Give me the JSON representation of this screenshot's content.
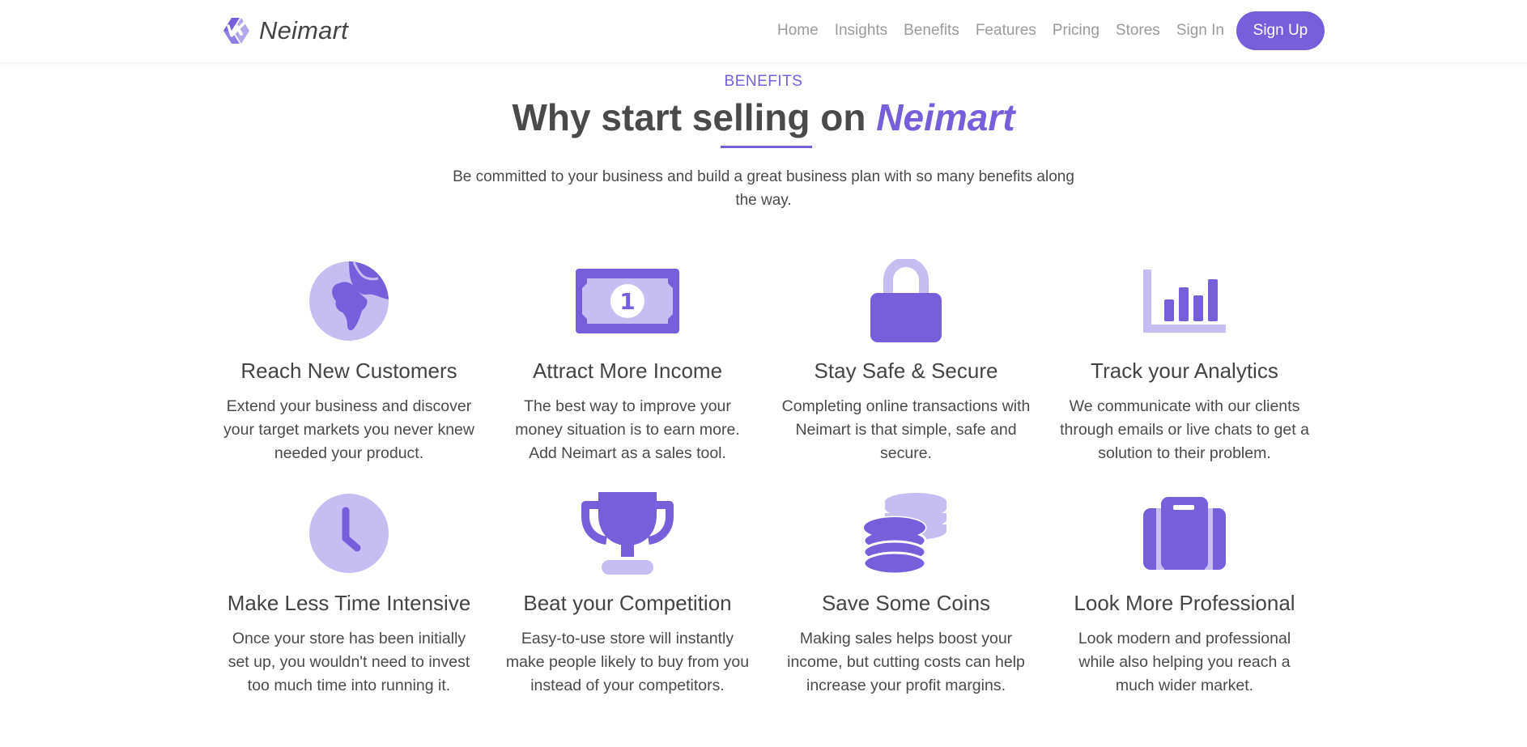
{
  "brand": {
    "name": "Neimart",
    "logo_icon": "neimart-logo-icon"
  },
  "nav": {
    "links": [
      "Home",
      "Insights",
      "Benefits",
      "Features",
      "Pricing",
      "Stores",
      "Sign In"
    ],
    "cta": "Sign Up"
  },
  "benefits": {
    "eyebrow": "BENEFITS",
    "title_lead": "Why start selling on ",
    "title_accent": "Neimart",
    "subtitle": "Be committed to your business and build a great business plan with so many benefits along the way.",
    "items": [
      {
        "icon": "globe-icon",
        "title": "Reach New Customers",
        "text": "Extend your business and discover your target markets you never knew needed your product."
      },
      {
        "icon": "banknote-icon",
        "title": "Attract More Income",
        "text": "The best way to improve your money situation is to earn more. Add Neimart as a sales tool."
      },
      {
        "icon": "lock-icon",
        "title": "Stay Safe & Secure",
        "text": "Completing online transactions with Neimart is that simple, safe and secure."
      },
      {
        "icon": "bar-chart-icon",
        "title": "Track your Analytics",
        "text": "We communicate with our clients through emails or live chats to get a solution to their problem."
      },
      {
        "icon": "clock-icon",
        "title": "Make Less Time Intensive",
        "text": "Once your store has been initially set up, you wouldn't need to invest too much time into running it."
      },
      {
        "icon": "trophy-icon",
        "title": "Beat your Competition",
        "text": "Easy-to-use store will instantly make people likely to buy from you instead of your competitors."
      },
      {
        "icon": "coins-icon",
        "title": "Save Some Coins",
        "text": "Making sales helps boost your income, but cutting costs can help increase your profit margins."
      },
      {
        "icon": "briefcase-icon",
        "title": "Look More Professional",
        "text": "Look modern and professional while also helping you reach a much wider market."
      }
    ],
    "banknote_digit": "1"
  },
  "colors": {
    "primary": "#775fdb",
    "primary_light": "#c6bdf2",
    "text": "#4a4a4a",
    "muted": "#9a9a9a"
  }
}
